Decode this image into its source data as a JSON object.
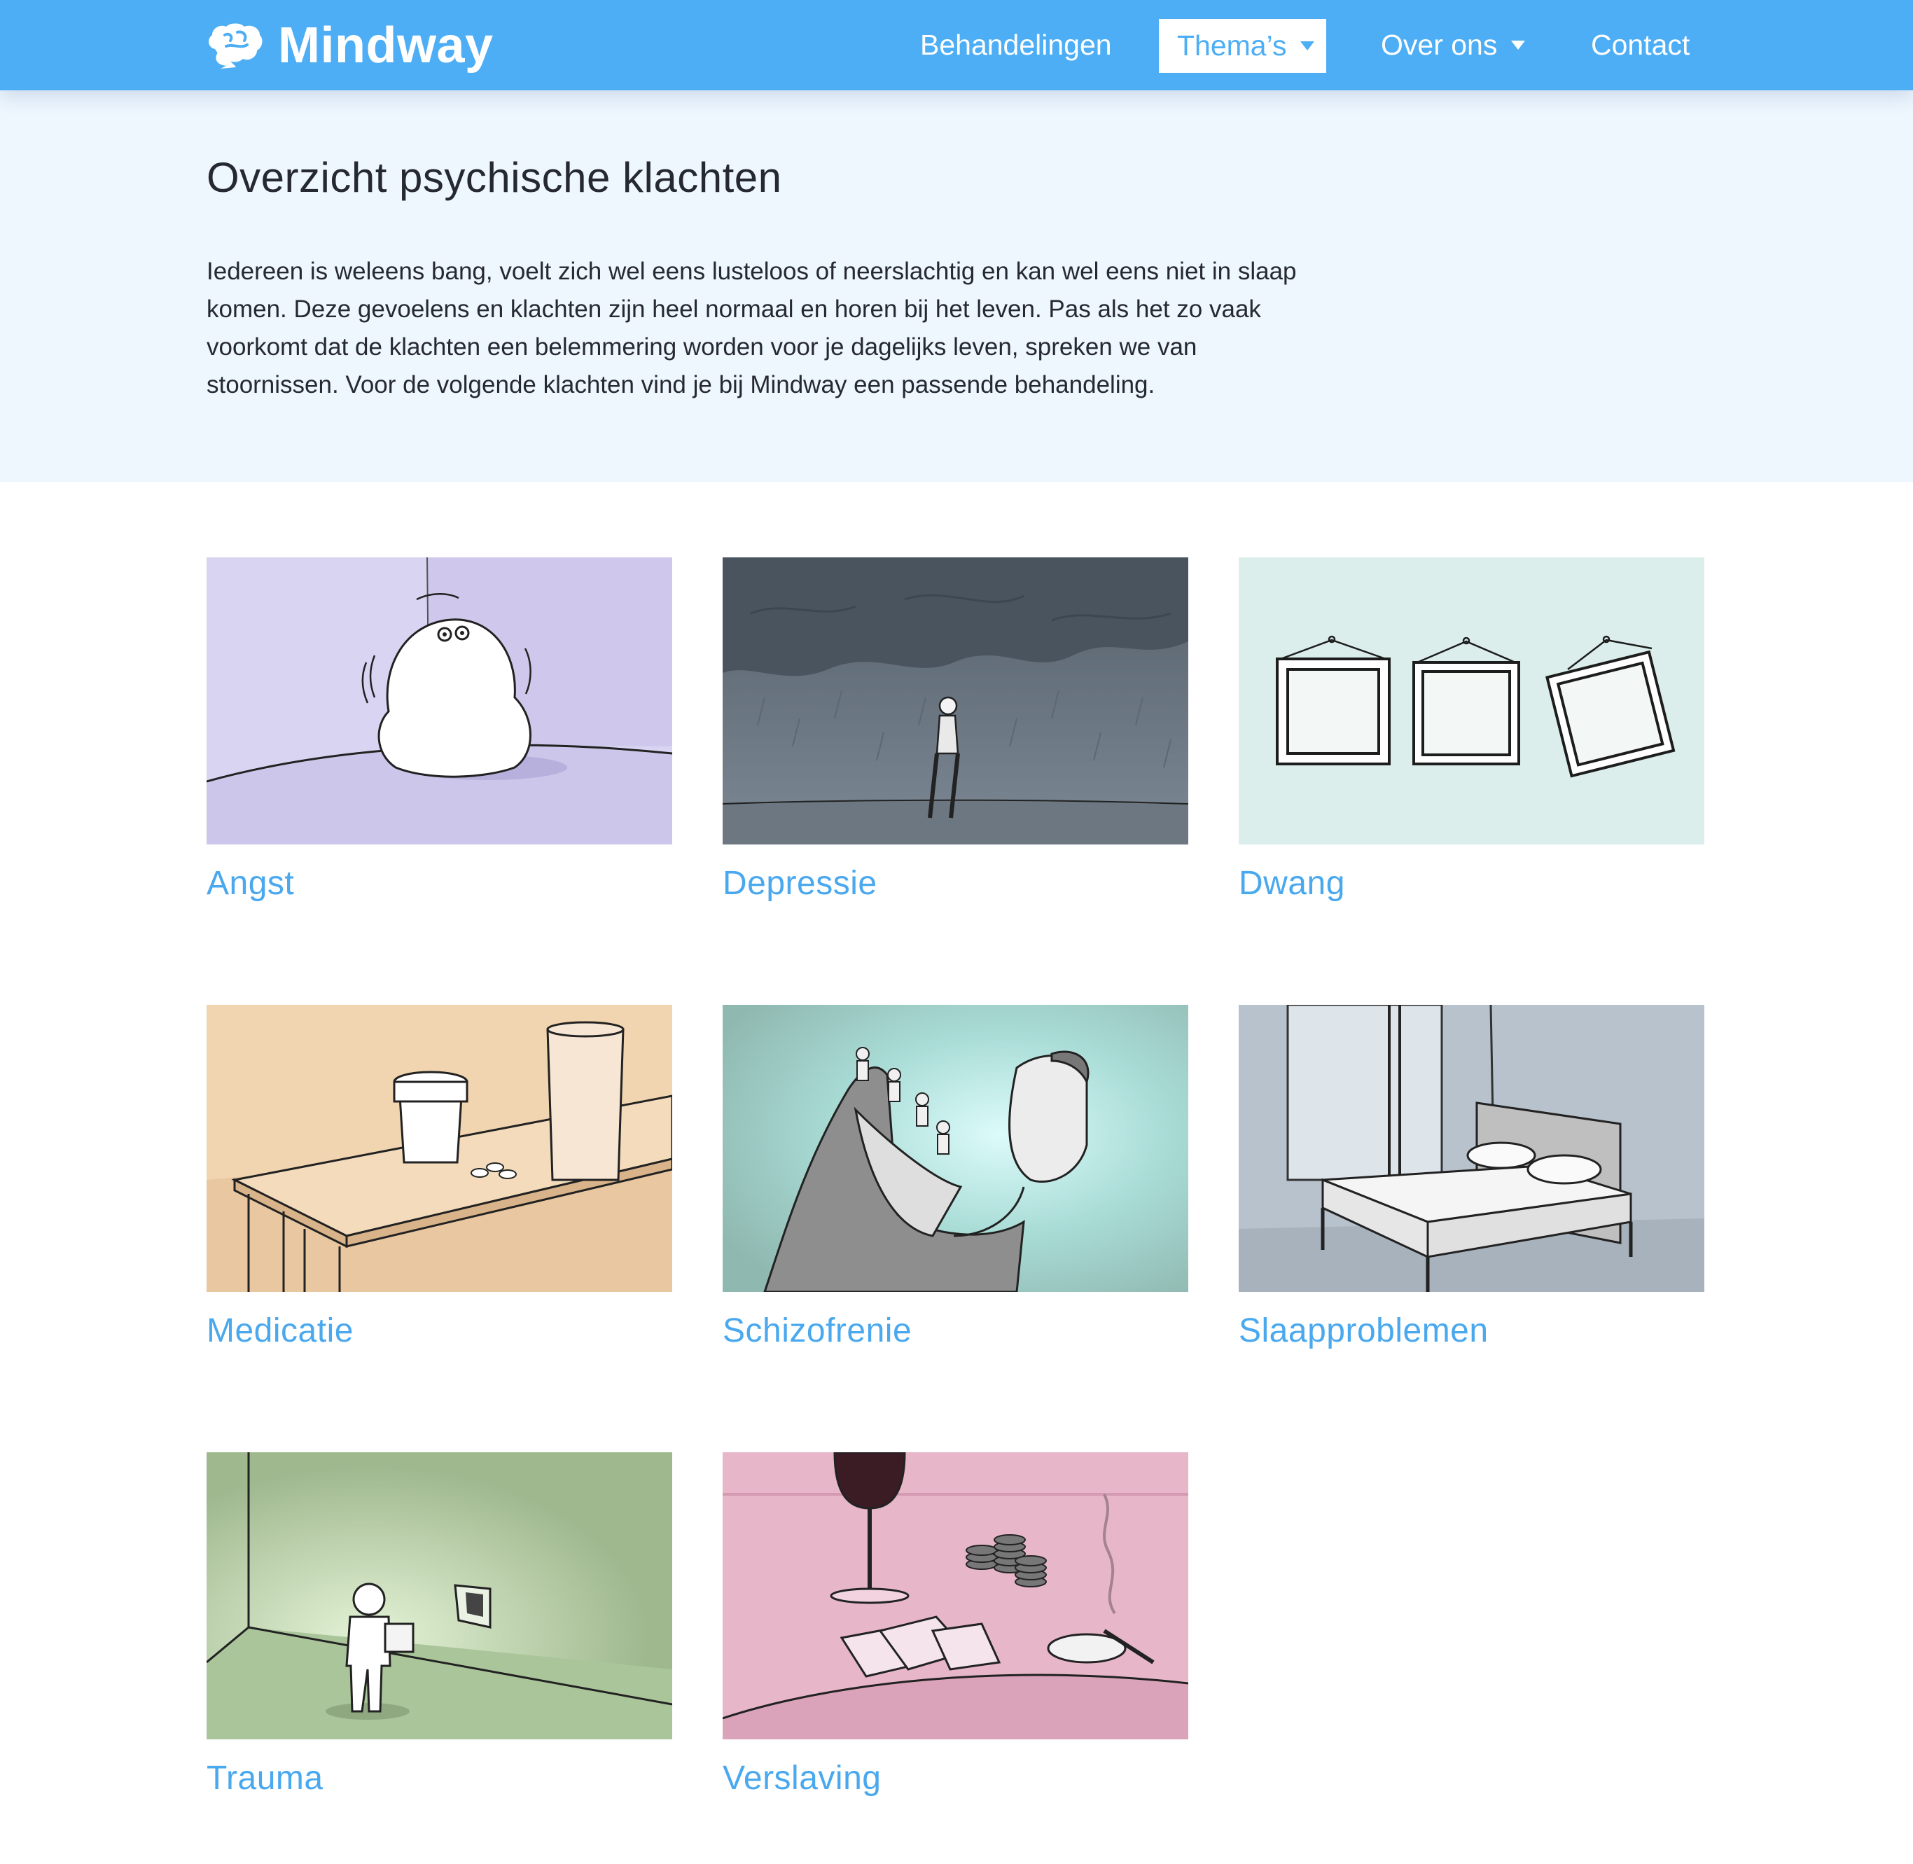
{
  "brand": {
    "name": "Mindway",
    "logo_icon": "brain-icon"
  },
  "nav": {
    "behandelingen": "Behandelingen",
    "themas": "Thema’s",
    "over_ons": "Over ons",
    "contact": "Contact"
  },
  "hero": {
    "title": "Overzicht psychische klachten",
    "text": "Iedereen is weleens bang, voelt zich wel eens lusteloos of neerslachtig en kan wel eens niet in slaap komen. Deze gevoelens en klachten zijn heel normaal en horen bij het leven. Pas als het zo vaak voorkomt dat de klachten een belemmering worden voor je dagelijks leven, spreken we van stoornissen. Voor de volgende klachten vind je bij Mindway een passende behandeling."
  },
  "themes": [
    {
      "title": "Angst"
    },
    {
      "title": "Depressie"
    },
    {
      "title": "Dwang"
    },
    {
      "title": "Medicatie"
    },
    {
      "title": "Schizofrenie"
    },
    {
      "title": "Slaapproblemen"
    },
    {
      "title": "Trauma"
    },
    {
      "title": "Verslaving"
    }
  ],
  "colors": {
    "navbar": "#4daef5",
    "hero_background": "#eef6fe",
    "link": "#4aa8ee",
    "text": "#262a30"
  }
}
